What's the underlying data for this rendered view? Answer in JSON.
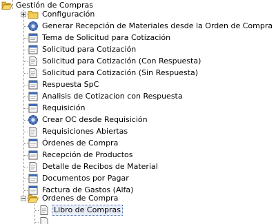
{
  "tree": {
    "root": {
      "label": "Gestión de Compras",
      "icon": "folder-open-icon"
    },
    "items": [
      {
        "label": "Configuración",
        "icon": "folder-closed-icon",
        "expanded": false
      },
      {
        "label": "Generar Recepción de Materiales desde la Orden de Compra",
        "icon": "process-gear-icon"
      },
      {
        "label": "Tema de Solicitud para Cotización",
        "icon": "window-icon"
      },
      {
        "label": "Solicitud para Cotización",
        "icon": "window-icon"
      },
      {
        "label": "Solicitud para Cotización (Con Respuesta)",
        "icon": "report-icon"
      },
      {
        "label": "Solicitud para Cotización  (Sin Respuesta)",
        "icon": "report-icon"
      },
      {
        "label": "Respuesta SpC",
        "icon": "window-icon"
      },
      {
        "label": "Analisis de Cotizacion con Respuesta",
        "icon": "window-icon"
      },
      {
        "label": "Requisición",
        "icon": "window-icon"
      },
      {
        "label": "Crear OC desde Requisición",
        "icon": "process-gear-icon"
      },
      {
        "label": "Requisiciones Abiertas",
        "icon": "report-icon"
      },
      {
        "label": "Órdenes de Compra",
        "icon": "window-icon"
      },
      {
        "label": "Recepción de Productos",
        "icon": "window-icon"
      },
      {
        "label": "Detalle de Recibos de Material",
        "icon": "report-icon"
      },
      {
        "label": "Documentos por Pagar",
        "icon": "window-icon"
      },
      {
        "label": "Factura de Gastos (Alfa)",
        "icon": "window-icon"
      },
      {
        "label": "Ordenes de Compra",
        "icon": "folder-open-icon",
        "expanded": true
      }
    ],
    "subitems": [
      {
        "label": "Libro de Compras",
        "icon": "report-icon",
        "selected": true
      }
    ]
  }
}
